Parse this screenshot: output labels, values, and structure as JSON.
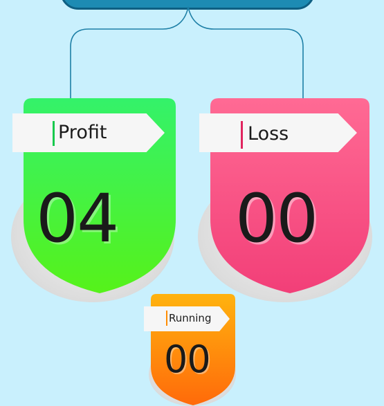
{
  "cards": {
    "profit": {
      "label": "Profit",
      "value": "04",
      "color_top": "#34f26a",
      "color_bottom": "#56f21a",
      "mark": "#18c94d"
    },
    "loss": {
      "label": "Loss",
      "value": "00",
      "color_top": "#ff6a94",
      "color_bottom": "#f23f78",
      "mark": "#e0245e"
    },
    "running": {
      "label": "Running",
      "value": "00",
      "color_top": "#ffb30f",
      "color_bottom": "#ff6a0a",
      "mark": "#ff8c00"
    }
  },
  "colors": {
    "background": "#c9f0fd",
    "connector": "#1d7fa6",
    "header_bar": "#1d8bb3"
  }
}
